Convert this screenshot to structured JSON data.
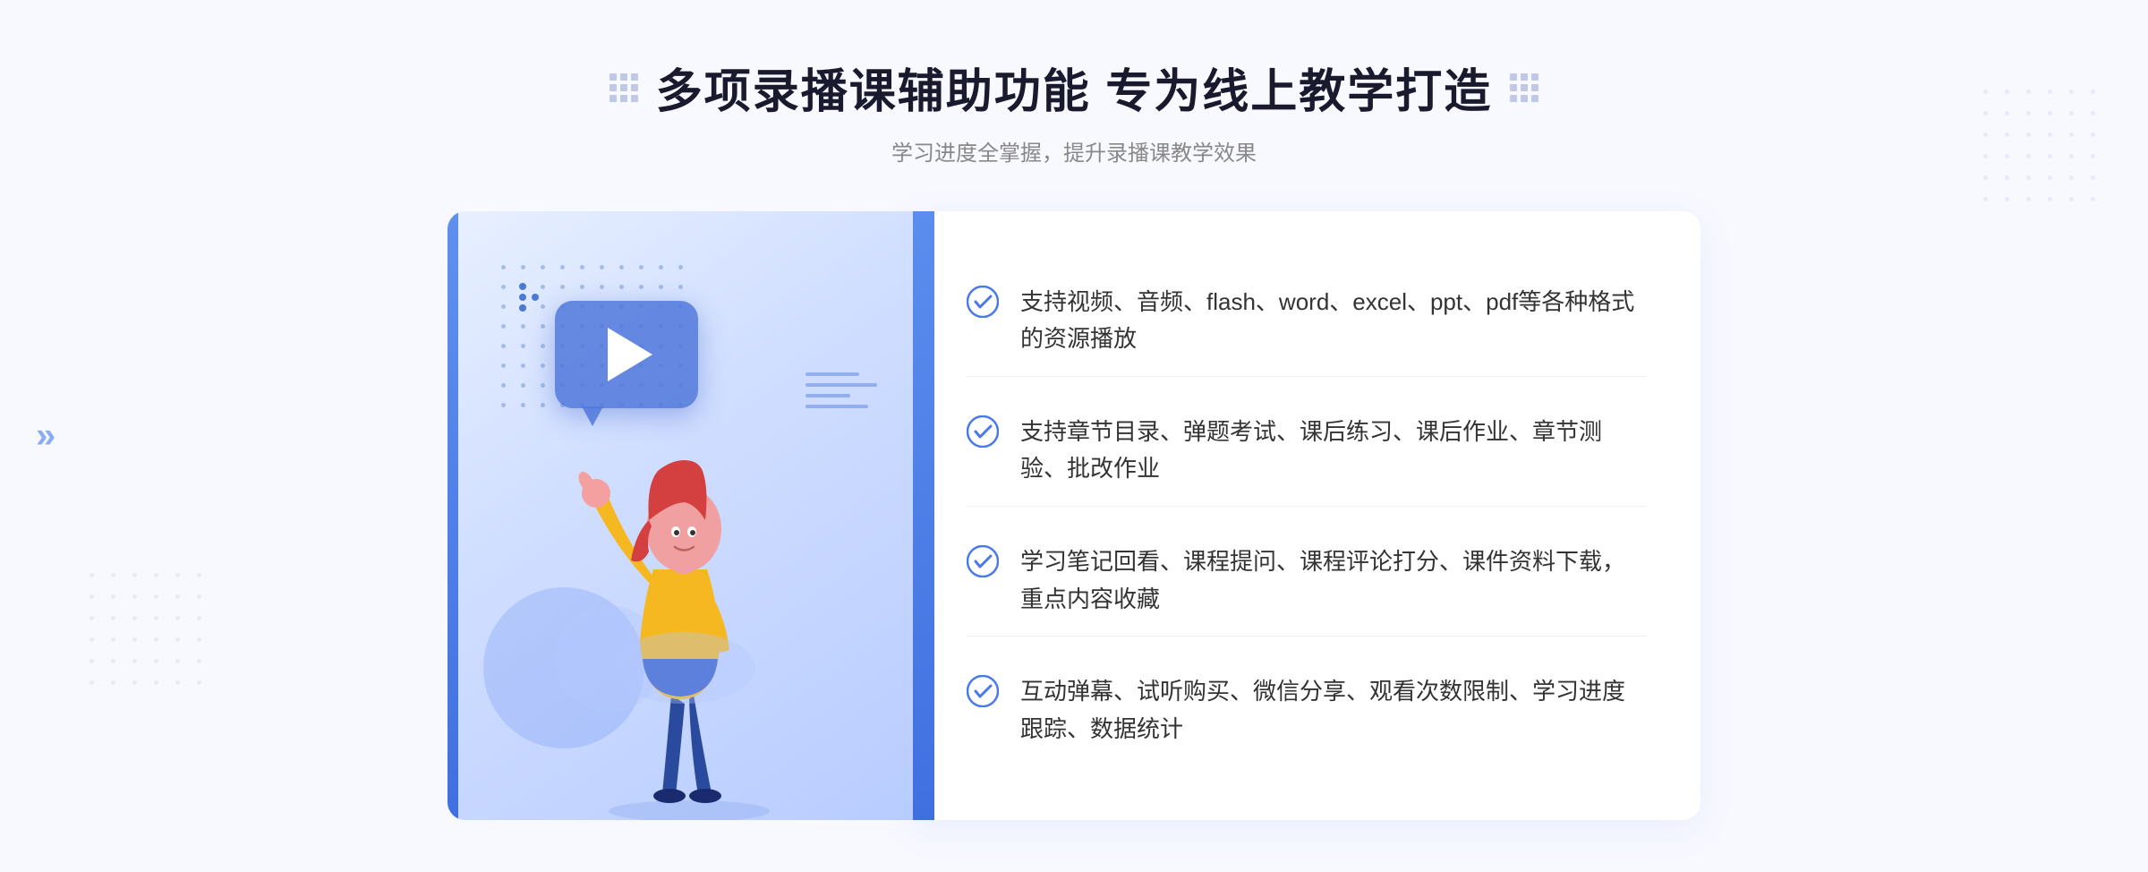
{
  "page": {
    "background": "#f8f9ff"
  },
  "header": {
    "title": "多项录播课辅助功能 专为线上教学打造",
    "subtitle": "学习进度全掌握，提升录播课教学效果"
  },
  "decorations": {
    "left_chevrons": "»",
    "title_grid_dots": ":::::"
  },
  "features": [
    {
      "id": 1,
      "text": "支持视频、音频、flash、word、excel、ppt、pdf等各种格式的资源播放"
    },
    {
      "id": 2,
      "text": "支持章节目录、弹题考试、课后练习、课后作业、章节测验、批改作业"
    },
    {
      "id": 3,
      "text": "学习笔记回看、课程提问、课程评论打分、课件资料下载，重点内容收藏"
    },
    {
      "id": 4,
      "text": "互动弹幕、试听购买、微信分享、观看次数限制、学习进度跟踪、数据统计"
    }
  ],
  "colors": {
    "primary_blue": "#4a7ae8",
    "light_blue": "#6a9ef5",
    "check_blue": "#4a7ae8",
    "text_dark": "#333333",
    "text_light": "#888888",
    "background": "#f8f9ff"
  }
}
